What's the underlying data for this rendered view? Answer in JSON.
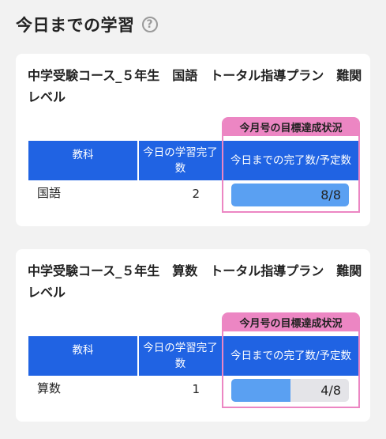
{
  "header": {
    "title": "今日までの学習",
    "help_icon": "question-circle-icon"
  },
  "cards": [
    {
      "title": "中学受験コース_５年生　国語　トータル指導プラン　難関レベル",
      "goal_tab": "今月号の目標達成状況",
      "columns": {
        "subject": "教科",
        "today": "今日の学習完了数",
        "goal": "今日までの完了数/予定数"
      },
      "row": {
        "subject": "国語",
        "today_count": "2",
        "progress_text": "8/8",
        "progress_fraction": 1.0
      }
    },
    {
      "title": "中学受験コース_５年生　算数　トータル指導プラン　難関レベル",
      "goal_tab": "今月号の目標達成状況",
      "columns": {
        "subject": "教科",
        "today": "今日の学習完了数",
        "goal": "今日までの完了数/予定数"
      },
      "row": {
        "subject": "算数",
        "today_count": "1",
        "progress_text": "4/8",
        "progress_fraction": 0.5
      }
    }
  ],
  "colors": {
    "header_blue": "#2063e3",
    "goal_pink": "#ec86c3",
    "progress_blue": "#5aa0f2"
  }
}
